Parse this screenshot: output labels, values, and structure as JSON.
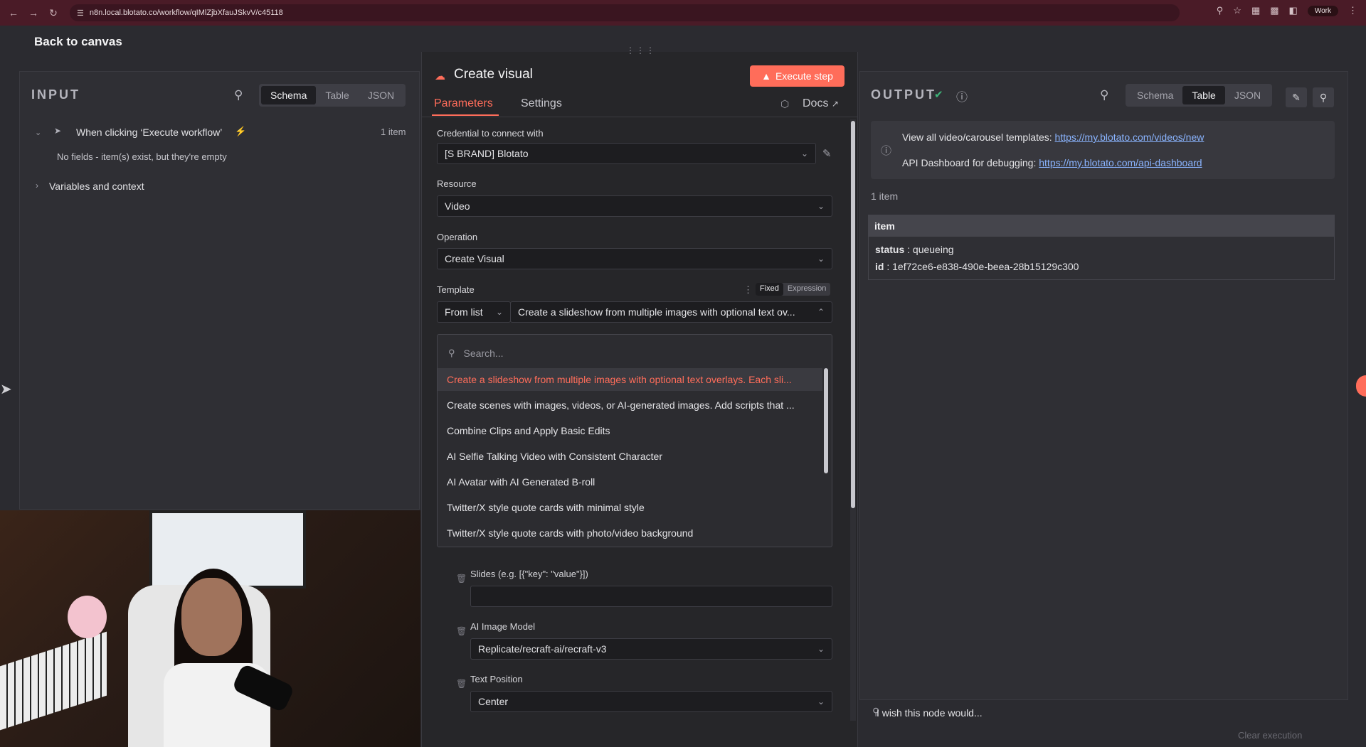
{
  "browser": {
    "url": "n8n.local.blotato.co/workflow/qIMlZjbXfauJSkvV/c45118",
    "profile": "Work"
  },
  "back_link": "Back to canvas",
  "input_panel": {
    "title": "INPUT",
    "view_tabs": [
      "Schema",
      "Table",
      "JSON"
    ],
    "active_tab": "Schema",
    "trigger_name": "When clicking ‘Execute workflow’",
    "item_count": "1 item",
    "empty_message": "No fields - item(s) exist, but they're empty",
    "variables_label": "Variables and context"
  },
  "node": {
    "title": "Create visual",
    "execute_label": "Execute step",
    "tabs": {
      "parameters": "Parameters",
      "settings": "Settings",
      "docs": "Docs"
    },
    "credential": {
      "label": "Credential to connect with",
      "value": "[S BRAND] Blotato"
    },
    "resource": {
      "label": "Resource",
      "value": "Video"
    },
    "operation": {
      "label": "Operation",
      "value": "Create Visual"
    },
    "template": {
      "label": "Template",
      "mode_fixed": "Fixed",
      "mode_expression": "Expression",
      "source": "From list",
      "value": "Create a slideshow from multiple images with optional text ov..."
    },
    "dropdown": {
      "search_placeholder": "Search...",
      "items": [
        "Create a slideshow from multiple images with optional text overlays. Each sli...",
        "Create scenes with images, videos, or AI-generated images. Add scripts that ...",
        "Combine Clips and Apply Basic Edits",
        "AI Selfie Talking Video with Consistent Character",
        "AI Avatar with AI Generated B-roll",
        "Twitter/X style quote cards with minimal style",
        "Twitter/X style quote cards with photo/video background"
      ]
    },
    "slides": {
      "label": "Slides (e.g. [{\"key\": \"value\"}])",
      "value": ""
    },
    "ai_image_model": {
      "label": "AI Image Model",
      "value": "Replicate/recraft-ai/recraft-v3"
    },
    "text_position": {
      "label": "Text Position",
      "value": "Center"
    }
  },
  "output_panel": {
    "title": "OUTPUT",
    "view_tabs": [
      "Schema",
      "Table",
      "JSON"
    ],
    "active_tab": "Table",
    "hint_line1_text": "View all video/carousel templates:",
    "hint_line1_link": "https://my.blotato.com/videos/new",
    "hint_line2_text": "API Dashboard for debugging:",
    "hint_line2_link": "https://my.blotato.com/api-dashboard",
    "item_count": "1 item",
    "table_header": "item",
    "status_key": "status",
    "status_value": "queueing",
    "id_key": "id",
    "id_value": "1ef72ce6-e838-490e-beea-28b15129c300"
  },
  "footer": {
    "wish": "I wish this node would...",
    "clear_execution": "Clear execution"
  },
  "colors": {
    "accent": "#ff6d5a",
    "link": "#8ab4ff",
    "browser_bar": "#4a1b27"
  }
}
